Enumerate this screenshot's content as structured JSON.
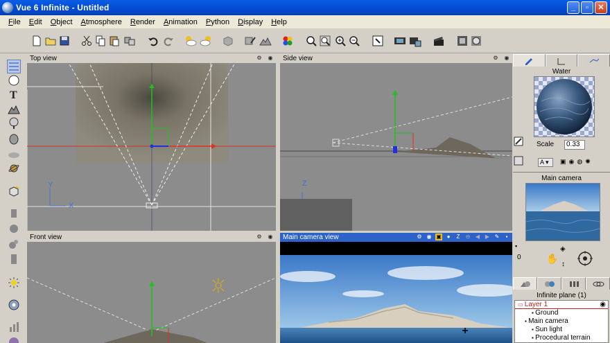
{
  "window": {
    "title": "Vue 6 Infinite - Untitled"
  },
  "menu": [
    {
      "pre": "",
      "u": "F",
      "post": "ile"
    },
    {
      "pre": "",
      "u": "E",
      "post": "dit"
    },
    {
      "pre": "",
      "u": "O",
      "post": "bject"
    },
    {
      "pre": "",
      "u": "A",
      "post": "tmosphere"
    },
    {
      "pre": "",
      "u": "R",
      "post": "ender"
    },
    {
      "pre": "",
      "u": "A",
      "post": "nimation"
    },
    {
      "pre": "",
      "u": "P",
      "post": "ython"
    },
    {
      "pre": "",
      "u": "D",
      "post": "isplay"
    },
    {
      "pre": "",
      "u": "H",
      "post": "elp"
    }
  ],
  "toolbar_icons": [
    "new-icon",
    "open-icon",
    "save-icon",
    "cut-icon",
    "copy-icon",
    "paste-icon",
    "duplicate-icon",
    "undo-icon",
    "redo-icon",
    "atmosphere-editor-icon",
    "load-atmosphere-icon",
    "object-icon",
    "material-editor-icon",
    "terrain-editor-icon",
    "color-icon",
    "zoom-icon",
    "zoom-fit-icon",
    "zoom-in-icon",
    "zoom-out-icon",
    "frame-icon",
    "render-icon",
    "render-area-icon",
    "animation-icon",
    "wireframe-icon",
    "display-options-icon"
  ],
  "left_tools": [
    "select-icon",
    "sphere-icon",
    "text-icon",
    "terrain-icon",
    "plant-icon",
    "rock-icon",
    "cloud-icon",
    "planet-icon",
    "load-object-icon",
    "cylinder-icon",
    "torus-icon",
    "cone-icon",
    "alpha-plane-icon",
    "light-icon",
    "camera-icon",
    "stats-icon",
    "metablob-icon"
  ],
  "viewports": {
    "top": {
      "title": "Top view",
      "axis_y": "Y",
      "axis_x": "X"
    },
    "side": {
      "title": "Side view",
      "axis_z": "Z"
    },
    "front": {
      "title": "Front view"
    },
    "camera": {
      "title": "Main camera view",
      "zoom_label": "Z"
    }
  },
  "right_panel": {
    "material_name": "Water",
    "scale_label": "Scale",
    "scale_value": "0.33",
    "mapping_label": "A",
    "camera_name": "Main camera",
    "camera_number": "0",
    "object_title": "Infinite plane (1)",
    "layers": [
      {
        "label": "Layer 1",
        "indent": 0,
        "selected": true
      },
      {
        "label": "Ground",
        "indent": 2,
        "selected": false
      },
      {
        "label": "Main camera",
        "indent": 1,
        "selected": false
      },
      {
        "label": "Sun light",
        "indent": 2,
        "selected": false
      },
      {
        "label": "Procedural terrain",
        "indent": 2,
        "selected": false
      }
    ]
  },
  "colors": {
    "title_bar": "#0450d8",
    "active_viewport_header": "#2d63c8",
    "axis_red": "#e03020",
    "axis_green": "#20c020",
    "axis_blue": "#2030e0"
  }
}
